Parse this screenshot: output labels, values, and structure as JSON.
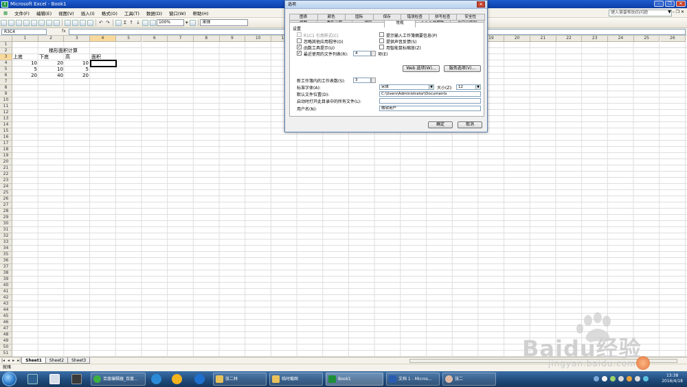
{
  "window": {
    "title": "Microsoft Excel - Book1"
  },
  "menu": {
    "items": [
      "文件(F)",
      "编辑(E)",
      "视图(V)",
      "插入(I)",
      "格式(O)",
      "工具(T)",
      "数据(D)",
      "窗口(W)",
      "帮助(H)"
    ],
    "help_box": "键入需要帮助的问题"
  },
  "toolbar": {
    "zoom": "100%",
    "font": "宋体"
  },
  "formula_bar": {
    "name_box": "R3C4",
    "fx": "fx",
    "content": ""
  },
  "sheet": {
    "columns": [
      "1",
      "2",
      "3",
      "4",
      "5",
      "6",
      "7",
      "8",
      "9",
      "10",
      "11",
      "12",
      "13",
      "14",
      "15",
      "16",
      "17",
      "18",
      "19",
      "20",
      "21",
      "22",
      "23",
      "24",
      "25",
      "26"
    ],
    "rows": [
      "1",
      "2",
      "3",
      "4",
      "5",
      "6",
      "7",
      "8",
      "9",
      "10",
      "11",
      "12",
      "13",
      "14",
      "15",
      "16",
      "17",
      "18",
      "19",
      "20",
      "21",
      "22",
      "23",
      "24",
      "25",
      "26",
      "27",
      "28",
      "29",
      "30",
      "31",
      "32",
      "33",
      "34",
      "35",
      "36",
      "37",
      "38",
      "39",
      "40",
      "41",
      "42",
      "43",
      "44",
      "45",
      "46",
      "47",
      "48",
      "49",
      "50",
      "51"
    ],
    "selected_column": "4",
    "selected_row": "3",
    "cells": {
      "title": "梯形面积计算",
      "h_top": "上底",
      "h_bottom": "下底",
      "h_height": "高",
      "h_area": "面积",
      "r3": [
        "10",
        "20",
        "10"
      ],
      "r4": [
        "5",
        "10",
        "5"
      ],
      "r5": [
        "20",
        "40",
        "20"
      ]
    }
  },
  "sheet_tabs": [
    "Sheet1",
    "Sheet2",
    "Sheet3"
  ],
  "status": "就绪",
  "dialog": {
    "title": "选项",
    "tabs_row1": [
      "图表",
      "颜色",
      "国际",
      "保存",
      "错误检查",
      "拼写检查",
      "安全性"
    ],
    "tabs_row2": [
      "视图",
      "重新计算",
      "编辑",
      "常规",
      "1-2-3 的帮助",
      "自定义序列"
    ],
    "active_tab": "常规",
    "section_label": "设置",
    "left_checks": [
      {
        "label": "R1C1 引用样式(C)",
        "checked": false,
        "disabled": true
      },
      {
        "label": "忽略其他应用程序(O)",
        "checked": false,
        "disabled": false
      },
      {
        "label": "函数工具提示(U)",
        "checked": true,
        "disabled": false
      },
      {
        "label": "最近使用的文件列表(R):",
        "checked": true,
        "disabled": false
      }
    ],
    "right_checks": [
      {
        "label": "提示输入工作簿摘要信息(P)",
        "checked": false
      },
      {
        "label": "提供声音反馈(S)",
        "checked": false
      },
      {
        "label": "用智能鼠标缩放(Z)",
        "checked": false
      }
    ],
    "recent_count": "4",
    "recent_unit": "项(E)",
    "web_options": "Web 选项(W)...",
    "service_options": "服务选项(V)...",
    "sheets_label": "新工作簿内的工作表数(S):",
    "sheets_value": "3",
    "font_label": "标准字体(A):",
    "font_value": "宋体",
    "size_label": "大小(Z):",
    "size_value": "12",
    "default_path_label": "默认文件位置(D):",
    "default_path_value": "C:\\Users\\Administrator\\Documents",
    "startup_label": "启动时打开此目录中的所有文件(L):",
    "startup_value": "",
    "username_label": "用户名(N):",
    "username_value": "微软用户",
    "ok": "确定",
    "cancel": "取消"
  },
  "taskbar": {
    "items": [
      "百度编辑器_百度...",
      "张二林",
      "临时截图",
      "Book1",
      "文档 1 - Micros...",
      "张二"
    ],
    "time": "13:38",
    "date": "2016/4/18",
    "lang": "CH"
  },
  "watermark": {
    "brand": "Baidu经验",
    "url": "jingyan.baidu.com"
  }
}
